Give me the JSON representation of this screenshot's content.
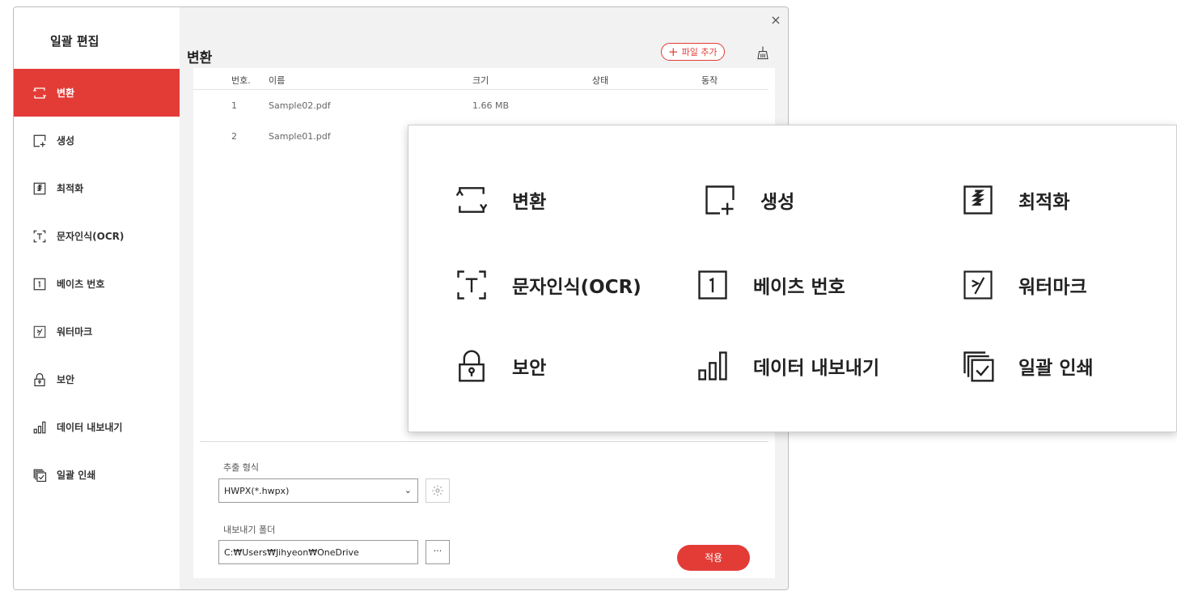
{
  "sidebar": {
    "title": "일괄 편집",
    "items": [
      {
        "label": "변환",
        "icon": "convert-icon",
        "active": true
      },
      {
        "label": "생성",
        "icon": "create-icon"
      },
      {
        "label": "최적화",
        "icon": "optimize-icon"
      },
      {
        "label": "문자인식(OCR)",
        "icon": "ocr-icon"
      },
      {
        "label": "베이츠 번호",
        "icon": "bates-number-icon"
      },
      {
        "label": "워터마크",
        "icon": "watermark-icon"
      },
      {
        "label": "보안",
        "icon": "lock-icon"
      },
      {
        "label": "데이터 내보내기",
        "icon": "bar-chart-icon"
      },
      {
        "label": "일괄 인쇄",
        "icon": "batch-print-icon"
      }
    ]
  },
  "main": {
    "title": "변환",
    "add_file_label": "파일 추가",
    "add_file_plus": "+",
    "table": {
      "headers": {
        "no": "번호.",
        "name": "이름",
        "size": "크기",
        "status": "상태",
        "action": "동작"
      },
      "rows": [
        {
          "no": "1",
          "name": "Sample02.pdf",
          "size": "1.66 MB"
        },
        {
          "no": "2",
          "name": "Sample01.pdf",
          "size": ""
        }
      ]
    },
    "format": {
      "label": "추출 형식",
      "value": "HWPX(*.hwpx)"
    },
    "folder": {
      "label": "내보내기 폴더",
      "value": "C:₩Users₩Jihyeon₩OneDrive",
      "browse_label": "···"
    },
    "apply_label": "적용"
  },
  "close_label": "×",
  "popup": {
    "items": [
      {
        "label": "변환",
        "icon": "convert-icon"
      },
      {
        "label": "생성",
        "icon": "create-icon"
      },
      {
        "label": "최적화",
        "icon": "optimize-icon"
      },
      {
        "label": "문자인식(OCR)",
        "icon": "ocr-icon"
      },
      {
        "label": "베이츠 번호",
        "icon": "bates-number-icon"
      },
      {
        "label": "워터마크",
        "icon": "watermark-icon"
      },
      {
        "label": "보안",
        "icon": "lock-icon"
      },
      {
        "label": "데이터 내보내기",
        "icon": "bar-chart-icon"
      },
      {
        "label": "일괄 인쇄",
        "icon": "batch-print-icon"
      }
    ]
  },
  "colors": {
    "accent": "#e33c37",
    "panel_bg": "#f2f2f2"
  }
}
